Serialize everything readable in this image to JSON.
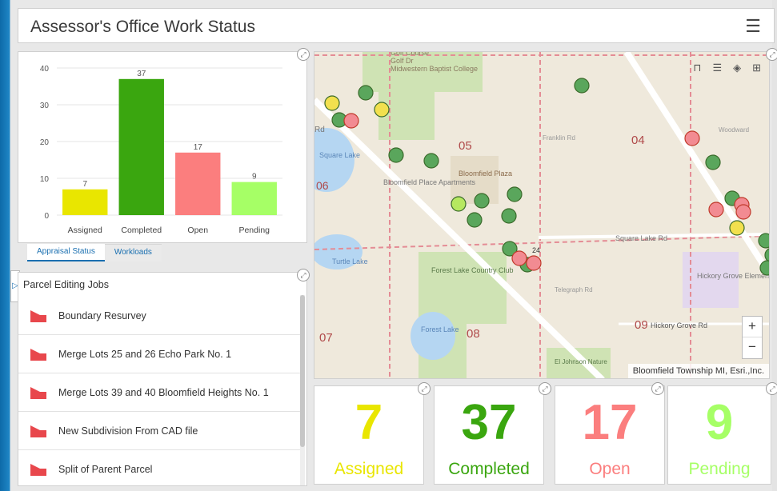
{
  "header": {
    "title": "Assessor's Office Work Status",
    "menu_icon": "hamburger-icon"
  },
  "chart_data": {
    "type": "bar",
    "categories": [
      "Assigned",
      "Completed",
      "Open",
      "Pending"
    ],
    "values": [
      7,
      37,
      17,
      9
    ],
    "colors": [
      "#e9e600",
      "#3aa60f",
      "#fb7e7e",
      "#a6ff66"
    ],
    "ylim": [
      0,
      40
    ],
    "yticks": [
      0,
      10,
      20,
      30,
      40
    ],
    "grid": true
  },
  "tabs": [
    {
      "label": "Appraisal Status",
      "active": true
    },
    {
      "label": "Workloads",
      "active": false
    }
  ],
  "list": {
    "title": "Parcel Editing Jobs",
    "items": [
      "Boundary Resurvey",
      "Merge Lots 25 and 26 Echo Park No. 1",
      "Merge Lots 39 and 40 Bloomfield Heights No. 1",
      "New Subdivision From CAD file",
      "Split of Parent Parcel"
    ],
    "item_icon": "parcel-polygon-icon",
    "icon_color": "#e8474c"
  },
  "map": {
    "labels": [
      "Golf Course",
      "Golf Dr",
      "Midwestern Baptist College",
      "Rd",
      "Square Lake",
      "06",
      "Bloomfield Place Apartments",
      "05",
      "Bloomfield Plaza",
      "Franklin Rd",
      "04",
      "Woodward",
      "Square Lake Rd",
      "24",
      "Turtle Lake",
      "Forest Lake Country Club",
      "Telegraph Rd",
      "Hickory Grove Elementary",
      "09",
      "Hickory Grove Rd",
      "Forest Lake",
      "07",
      "08",
      "El Johnson Nature"
    ],
    "attribution": "Bloomfield Township MI, Esri.,Inc.",
    "zoom_in": "+",
    "zoom_out": "−",
    "toolbar": [
      "basemap-gallery-icon",
      "legend-icon",
      "layers-icon",
      "qr-icon"
    ],
    "status_colors": {
      "assigned": "#f2e04e",
      "completed": "#5aa65c",
      "open": "#f28b92",
      "pending": "#b6e860"
    }
  },
  "indicators": [
    {
      "value": "7",
      "label": "Assigned",
      "color": "#e9e600"
    },
    {
      "value": "37",
      "label": "Completed",
      "color": "#3aa60f"
    },
    {
      "value": "17",
      "label": "Open",
      "color": "#fb7e7e"
    },
    {
      "value": "9",
      "label": "Pending",
      "color": "#a6ff66"
    }
  ]
}
